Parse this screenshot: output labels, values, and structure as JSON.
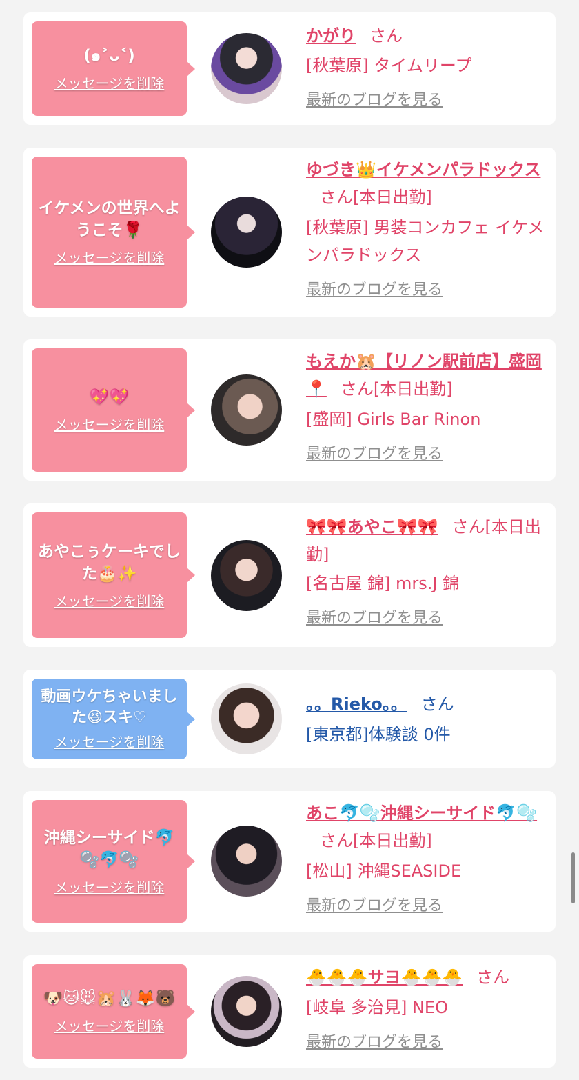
{
  "delete_label": "メッセージを削除",
  "blog_label": "最新のブログを見る",
  "san_label": "さん",
  "items": [
    {
      "bubble_text": "(๑˃ᴗ˂)",
      "name": "かがり",
      "status": "",
      "shop": "[秋葉原] タイムリープ",
      "theme": "pink"
    },
    {
      "bubble_text": "イケメンの世界へようこそ🌹",
      "name": "ゆづき👑イケメンパラドックス",
      "status": "[本日出勤]",
      "shop": "[秋葉原] 男装コンカフェ イケメンパラドックス",
      "theme": "pink"
    },
    {
      "bubble_text": "💖💖",
      "name": "もえか🐹【リノン駅前店】盛岡📍",
      "status": "[本日出勤]",
      "shop": "[盛岡] Girls Bar Rinon",
      "theme": "pink"
    },
    {
      "bubble_text": "あやこぅケーキでした🎂✨",
      "name": "🎀🎀あやこ🎀🎀",
      "status": "[本日出勤]",
      "shop": "[名古屋 錦] mrs.J 錦",
      "theme": "pink"
    },
    {
      "bubble_text": "動画ウケちゃいました😆スキ♡",
      "name": "。。Rieko。。",
      "status": "",
      "shop": "[東京都]体験談 0件",
      "theme": "blue"
    },
    {
      "bubble_text": "沖縄シーサイド🐬🫧🐬🫧",
      "name": "あこ🐬🫧沖縄シーサイド🐬🫧",
      "status": "[本日出勤]",
      "shop": "[松山] 沖縄SEASIDE",
      "theme": "pink"
    },
    {
      "bubble_text": "🐶🐱🐭🐹🐰🦊🐻",
      "name": "🐣🐣🐣サヨ🐣🐣🐣",
      "status": "",
      "shop": "[岐阜 多治見] NEO",
      "theme": "pink"
    }
  ],
  "colors": {
    "pink_bubble": "#f7909f",
    "blue_bubble": "#7fb2f2",
    "pink_text": "#e04468",
    "blue_text": "#2459a8",
    "blog_gray": "#8f8f8f"
  }
}
